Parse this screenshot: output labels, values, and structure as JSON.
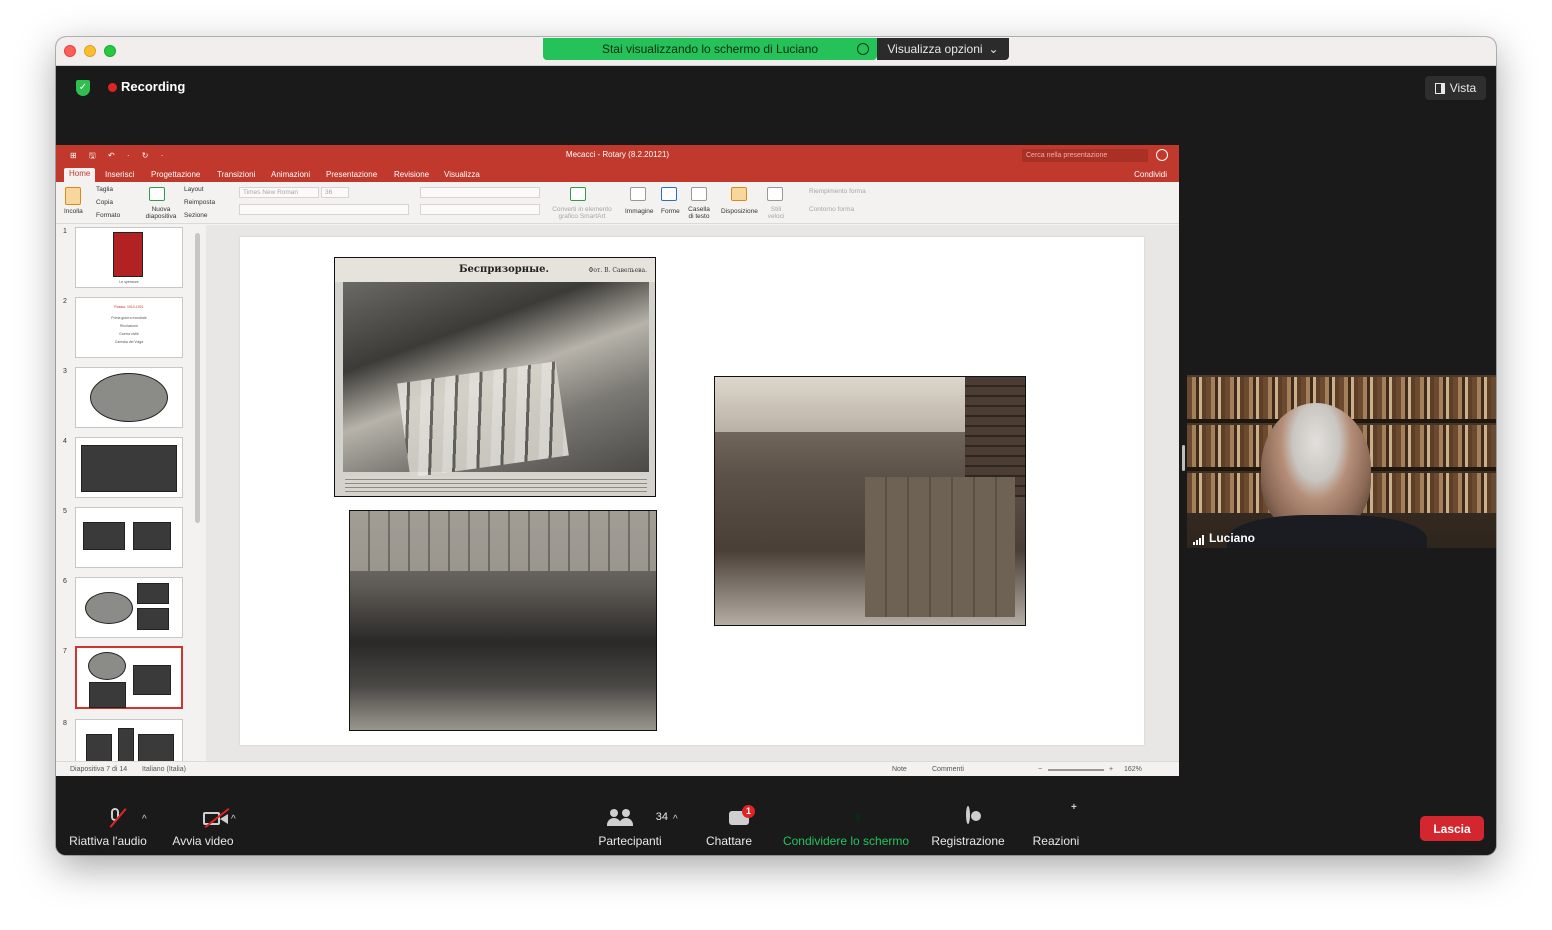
{
  "share_banner": {
    "text": "Stai visualizzando lo schermo di Luciano",
    "options_label": "Visualizza opzioni",
    "options_chevron": "⌄"
  },
  "meeting": {
    "recording_label": "Recording",
    "view_label": "Vista"
  },
  "ppt": {
    "title": "Mecacci - Rotary (8.2.20121)",
    "search_placeholder": "Cerca nella presentazione",
    "quick_access": "⊞ 🖫 ↶ · ↻ ·",
    "tabs": [
      "Home",
      "Inserisci",
      "Progettazione",
      "Transizioni",
      "Animazioni",
      "Presentazione",
      "Revisione",
      "Visualizza"
    ],
    "share_label": "Condividi",
    "ribbon": {
      "paste": "Incolla",
      "cut": "Taglia",
      "copy": "Copia",
      "format": "Formato",
      "new_slide": "Nuova diapositiva",
      "layout": "Layout",
      "reset": "Reimposta",
      "section": "Sezione",
      "font": "Times New Roman",
      "font_size": "36",
      "smartart": "Converti in elemento grafico SmartArt",
      "image": "Immagine",
      "shapes": "Forme",
      "textbox": "Casella di testo",
      "arrange": "Disposizione",
      "quick_styles": "Stili veloci",
      "shape_fill": "Riempimento forma",
      "shape_outline": "Contorno forma"
    },
    "slides": [
      {
        "number": "1",
        "caption": "Le speranze"
      },
      {
        "number": "2",
        "lines": [
          "Russia, 1914-1921",
          "Prima guerra mondiale",
          "Rivoluzione",
          "Guerra civile",
          "Carestia del Volga"
        ]
      },
      {
        "number": "3"
      },
      {
        "number": "4"
      },
      {
        "number": "5"
      },
      {
        "number": "6"
      },
      {
        "number": "7"
      },
      {
        "number": "8"
      }
    ],
    "selected_slide": 7,
    "photo1": {
      "title": "Беспризорные.",
      "credit": "Фот. В. Савельева."
    },
    "status": {
      "slide_count": "Diapositiva 7 di 14",
      "language": "Italiano (Italia)",
      "notes": "Note",
      "comments": "Commenti",
      "zoom_minus": "−",
      "zoom_plus": "+",
      "zoom": "162%"
    }
  },
  "participant": {
    "name": "Luciano"
  },
  "toolbar": {
    "audio": "Riattiva l'audio",
    "video": "Avvia video",
    "participants": "Partecipanti",
    "participants_count": "34",
    "chat": "Chattare",
    "chat_badge": "1",
    "share": "Condividere lo schermo",
    "record": "Registrazione",
    "reactions": "Reazioni",
    "leave": "Lascia",
    "caret": "^"
  },
  "colors": {
    "share_green": "#25c25a",
    "ppt_red": "#c1392c",
    "leave_red": "#d3262f",
    "share_label_green": "#22c55e"
  }
}
